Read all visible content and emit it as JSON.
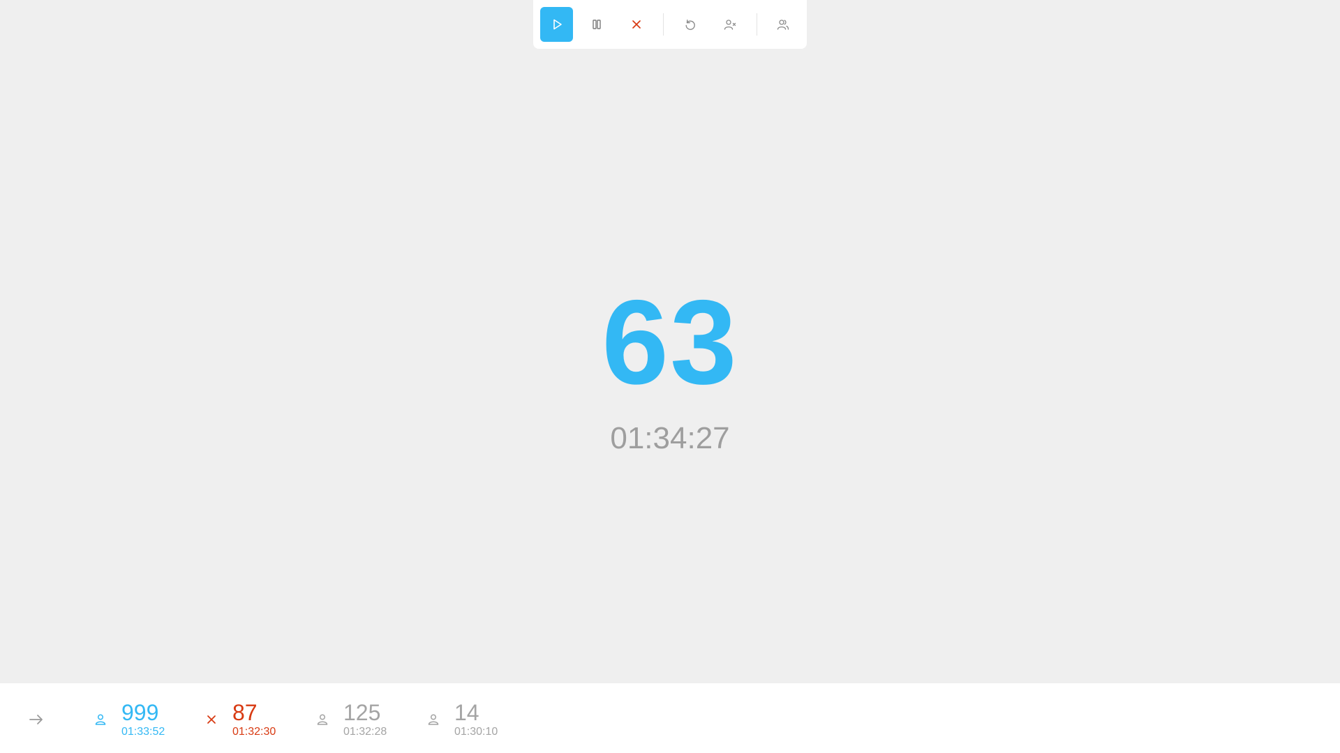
{
  "toolbar": {
    "buttons": [
      {
        "icon": "play-icon",
        "active": true
      },
      {
        "icon": "pause-icon",
        "active": false
      },
      {
        "icon": "close-icon",
        "active": false
      },
      {
        "icon": "undo-icon",
        "active": false
      },
      {
        "icon": "remove-user-icon",
        "active": false
      },
      {
        "icon": "users-icon",
        "active": false
      }
    ]
  },
  "main": {
    "current_number": "63",
    "current_time": "01:34:27"
  },
  "history": {
    "arrow_icon": "arrow-right-icon",
    "items": [
      {
        "icon": "user-icon",
        "value": "999",
        "time": "01:33:52",
        "color": "#33b8f4"
      },
      {
        "icon": "close-icon",
        "value": "87",
        "time": "01:32:30",
        "color": "#d83a12"
      },
      {
        "icon": "user-icon",
        "value": "125",
        "time": "01:32:28",
        "color": "#a4a4a4"
      },
      {
        "icon": "user-icon",
        "value": "14",
        "time": "01:30:10",
        "color": "#a4a4a4"
      }
    ]
  },
  "colors": {
    "accent": "#33b8f4",
    "danger": "#d83a12",
    "muted": "#a4a4a4",
    "background": "#efefef"
  }
}
